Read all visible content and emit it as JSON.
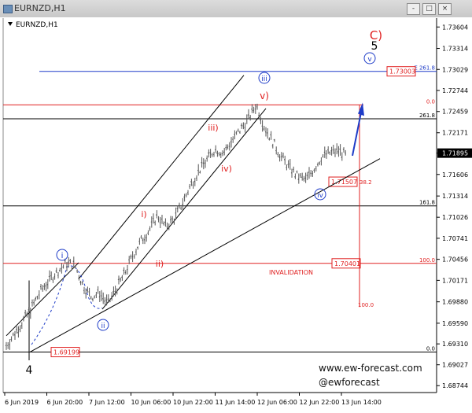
{
  "window": {
    "title": "EURNZD,H1",
    "buttons": [
      "-",
      "□",
      "×"
    ]
  },
  "chart_data": {
    "type": "candlestick",
    "symbol_label": "EURNZD,H1",
    "price_axis": {
      "range": [
        1.6864,
        1.7365
      ],
      "ticks": [
        "1.73604",
        "1.73314",
        "1.73029",
        "1.72744",
        "1.72459",
        "1.72171",
        "1.71895",
        "1.71606",
        "1.71314",
        "1.71026",
        "1.70741",
        "1.70456",
        "1.70171",
        "1.69880",
        "1.69590",
        "1.69310",
        "1.69027",
        "1.68744"
      ],
      "current_price": "1.71895"
    },
    "time_axis": {
      "ticks": [
        "6 Jun 2019",
        "6 Jun 20:00",
        "7 Jun 12:00",
        "10 Jun 06:00",
        "10 Jun 22:00",
        "11 Jun 14:00",
        "12 Jun 06:00",
        "12 Jun 22:00",
        "13 Jun 14:00"
      ]
    },
    "price_path": [
      [
        0,
        1.6925
      ],
      [
        3,
        1.695
      ],
      [
        6,
        1.6975
      ],
      [
        9,
        1.7005
      ],
      [
        12,
        1.7025
      ],
      [
        15,
        1.704
      ],
      [
        17,
        1.7038
      ],
      [
        19,
        1.701
      ],
      [
        21,
        1.6995
      ],
      [
        23,
        1.7
      ],
      [
        25,
        1.6985
      ],
      [
        27,
        1.7005
      ],
      [
        29,
        1.7025
      ],
      [
        31,
        1.705
      ],
      [
        33,
        1.707
      ],
      [
        35,
        1.7085
      ],
      [
        37,
        1.7105
      ],
      [
        39,
        1.709
      ],
      [
        41,
        1.71
      ],
      [
        43,
        1.712
      ],
      [
        45,
        1.7145
      ],
      [
        47,
        1.7165
      ],
      [
        49,
        1.718
      ],
      [
        51,
        1.7195
      ],
      [
        53,
        1.719
      ],
      [
        55,
        1.7205
      ],
      [
        57,
        1.722
      ],
      [
        59,
        1.7235
      ],
      [
        61,
        1.7255
      ],
      [
        63,
        1.7225
      ],
      [
        65,
        1.7205
      ],
      [
        67,
        1.7185
      ],
      [
        69,
        1.717
      ],
      [
        71,
        1.7158
      ],
      [
        73,
        1.7153
      ],
      [
        75,
        1.7168
      ],
      [
        77,
        1.7185
      ],
      [
        79,
        1.719
      ],
      [
        81,
        1.7193
      ],
      [
        83,
        1.7185
      ]
    ],
    "horizontal_levels": [
      {
        "label": "E 261.8",
        "price": 1.73003,
        "box": "1.73003",
        "color": "#1e3cc8"
      },
      {
        "label": "0.0",
        "price": 1.72549,
        "color": "#e02020"
      },
      {
        "label": "261.8",
        "price": 1.7236,
        "color": "#000000"
      },
      {
        "label": "161.8",
        "price": 1.7118,
        "color": "#000000"
      },
      {
        "label": "100.0",
        "price": 1.70401,
        "box": "1.70401",
        "color": "#e02020",
        "extra": "INVALIDATION"
      },
      {
        "label": "0.0",
        "price": 1.69199,
        "box": "1.69199",
        "color": "#000000"
      }
    ],
    "fib_labels": [
      {
        "text": "38.2",
        "price": 1.71507,
        "box": "1.71507"
      },
      {
        "text": "100.0",
        "price": 1.6981
      }
    ],
    "wave_labels": [
      {
        "text": "4",
        "color": "#000000"
      },
      {
        "text": "i",
        "color": "#1e3cc8",
        "circled": true
      },
      {
        "text": "ii",
        "color": "#1e3cc8",
        "circled": true
      },
      {
        "text": "i)",
        "color": "#e02020"
      },
      {
        "text": "ii)",
        "color": "#e02020"
      },
      {
        "text": "iii)",
        "color": "#e02020"
      },
      {
        "text": "iv)",
        "color": "#e02020"
      },
      {
        "text": "v)",
        "color": "#e02020"
      },
      {
        "text": "iii",
        "color": "#1e3cc8",
        "circled": true
      },
      {
        "text": "iv",
        "color": "#1e3cc8",
        "circled": true
      },
      {
        "text": "v",
        "color": "#1e3cc8",
        "circled": true
      },
      {
        "text": "5",
        "color": "#000000"
      },
      {
        "text": "C)",
        "color": "#e02020"
      }
    ],
    "watermark": [
      "www.ew-forecast.com",
      "@ewforecast"
    ],
    "colors": {
      "bars": "#555555",
      "blue": "#1e3cc8",
      "red": "#e02020",
      "channel": "#000000"
    }
  }
}
